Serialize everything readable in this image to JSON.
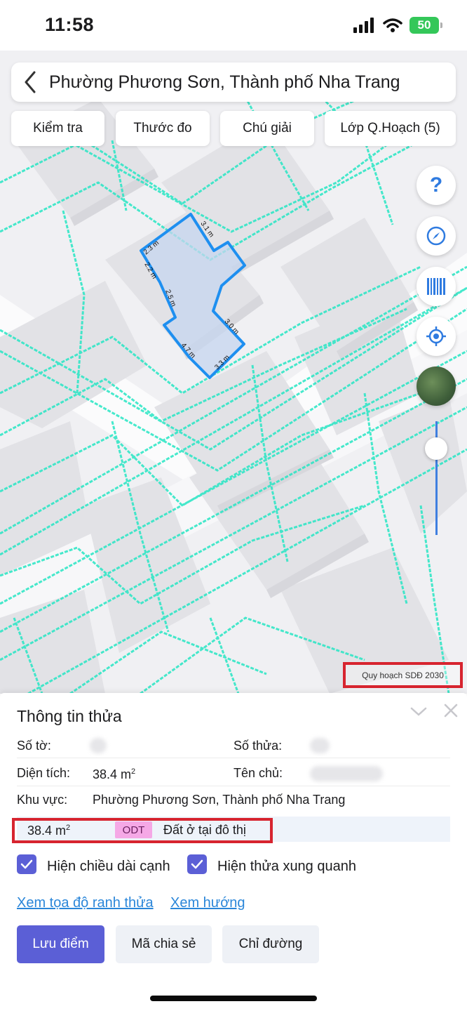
{
  "status_bar": {
    "time": "11:58",
    "battery": "50"
  },
  "header": {
    "location_title": "Phường Phương Sơn, Thành phố Nha Trang"
  },
  "toolbar": {
    "check": "Kiểm tra",
    "measure": "Thước đo",
    "legend": "Chú giải",
    "plan_layers": "Lớp Q.Hoạch (5)"
  },
  "map": {
    "edge_labels": [
      "3.1 m",
      "2.3 m",
      "2.2 m",
      "2.5 m",
      "3.0 m",
      "4.7 m",
      "3.3 m"
    ],
    "plan_layer_label": "Quy hoạch SDĐ 2030",
    "zoom_level": 0.85,
    "colors": {
      "parcel_outline": "#1e8ff0",
      "parcel_fill": "#c6d6ef",
      "plan_lines": "#27e6c4",
      "building": "#e3e3e7"
    }
  },
  "controls": [
    "help-icon",
    "compass-icon",
    "barcode-icon",
    "locate-icon",
    "satellite-layer-icon"
  ],
  "panel": {
    "title": "Thông tin thửa",
    "sheet_label": "Số tờ:",
    "parcel_label": "Số thửa:",
    "area_label": "Diện tích:",
    "area_value": "38.4 m",
    "area_unit_sup": "2",
    "owner_label": "Tên chủ:",
    "region_label": "Khu vực:",
    "region_value": "Phường Phương Sơn, Thành phố Nha Trang",
    "land_use": {
      "area": "38.4 m",
      "area_unit_sup": "2",
      "code": "ODT",
      "name": "Đất ở tại đô thị",
      "code_color": "#f5a8e6"
    },
    "show_edge_lengths": {
      "label": "Hiện chiều dài cạnh",
      "checked": true
    },
    "show_neighbors": {
      "label": "Hiện thửa xung quanh",
      "checked": true
    },
    "link_coords": "Xem tọa độ ranh thửa",
    "link_direction": "Xem hướng",
    "btn_save": "Lưu điểm",
    "btn_share": "Mã chia sẻ",
    "btn_directions": "Chỉ đường"
  }
}
